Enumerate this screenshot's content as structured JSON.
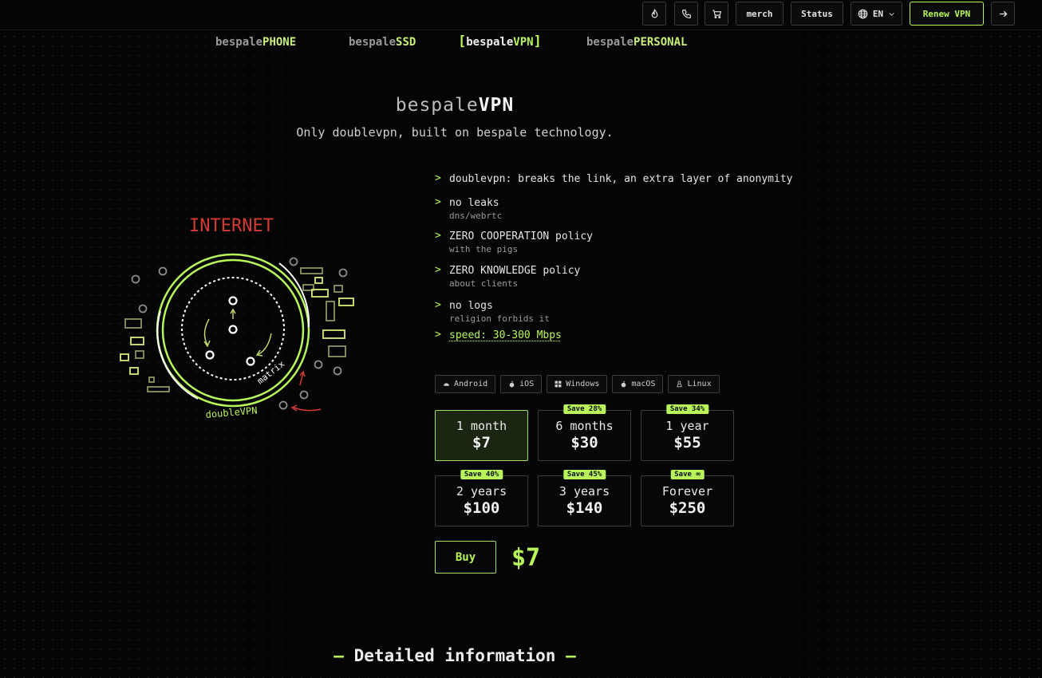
{
  "topbar": {
    "merch": "merch",
    "status": "Status",
    "language": "EN",
    "renew": "Renew VPN",
    "icons": [
      "flame-icon",
      "phone-icon",
      "cart-icon",
      "globe-icon",
      "chevron-down-icon",
      "arrow-right-icon"
    ]
  },
  "products": [
    {
      "prefix": "bespale",
      "suffix": "PHONE"
    },
    {
      "prefix": "bespale",
      "suffix": "SSD"
    },
    {
      "prefix": "bespale",
      "suffix": "VPN",
      "active": true
    },
    {
      "prefix": "bespale",
      "suffix": "PERSONAL"
    }
  ],
  "hero": {
    "title_prefix": "bespale",
    "title_suffix": "VPN",
    "subtitle": "Only doublevpn, built on bespale technology."
  },
  "diagram": {
    "internet": "INTERNET",
    "matrix": "matrix",
    "doublevpn": "doubleVPN"
  },
  "features": [
    {
      "title": "doublevpn: breaks the link, an extra layer of anonymity",
      "sub": ""
    },
    {
      "title": "no leaks",
      "sub": "dns/webrtc"
    },
    {
      "title": "ZERO COOPERATION policy",
      "sub": "with the pigs"
    },
    {
      "title": "ZERO KNOWLEDGE policy",
      "sub": "about clients"
    },
    {
      "title": "no logs",
      "sub": "religion forbids it"
    },
    {
      "title": "speed: 30-300 Mbps",
      "sub": ""
    }
  ],
  "platforms": [
    "Android",
    "iOS",
    "Windows",
    "macOS",
    "Linux"
  ],
  "plans": [
    {
      "name": "1 month",
      "price": "$7",
      "save": "",
      "selected": true
    },
    {
      "name": "6 months",
      "price": "$30",
      "save": "Save 28%"
    },
    {
      "name": "1 year",
      "price": "$55",
      "save": "Save 34%"
    },
    {
      "name": "2 years",
      "price": "$100",
      "save": "Save 40%"
    },
    {
      "name": "3 years",
      "price": "$140",
      "save": "Save 45%"
    },
    {
      "name": "Forever",
      "price": "$250",
      "save": "Save ∞"
    }
  ],
  "buy": {
    "label": "Buy",
    "total": "$7"
  },
  "detailed": {
    "dash_left": "–",
    "label": "Detailed information",
    "dash_right": "–"
  },
  "colors": {
    "accent": "#b8f55a",
    "internet": "#d23a32",
    "background": "#050505"
  }
}
